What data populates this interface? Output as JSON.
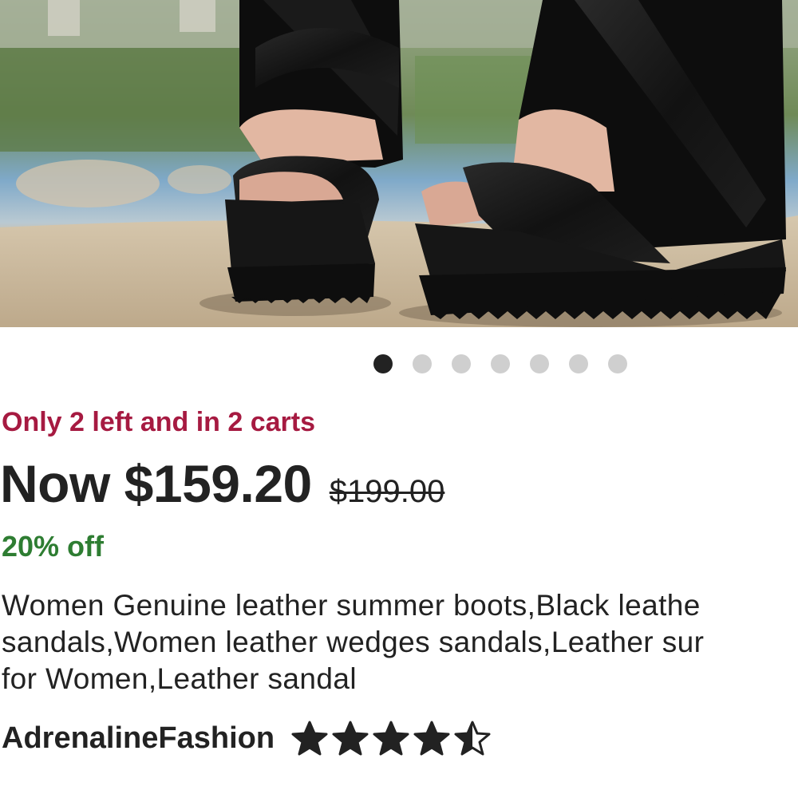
{
  "listing": {
    "image": {
      "carousel_total": 7,
      "carousel_active": 1
    },
    "stock_notice": "Only 2 left and in 2 carts",
    "price_now": "Now $159.20",
    "price_original": "$199.00",
    "discount": "20% off",
    "title_lines": [
      "Women Genuine leather summer boots,Black leathe",
      "sandals,Women leather wedges sandals,Leather sur",
      "for Women,Leather sandal"
    ],
    "shop": {
      "name": "AdrenalineFashion",
      "rating": 4.5,
      "rating_max": 5
    }
  },
  "colors": {
    "stock_notice": "#a61a41",
    "discount": "#2e7d32",
    "text": "#222222",
    "dot_active": "#222222",
    "dot_inactive": "#cfcfcf"
  }
}
